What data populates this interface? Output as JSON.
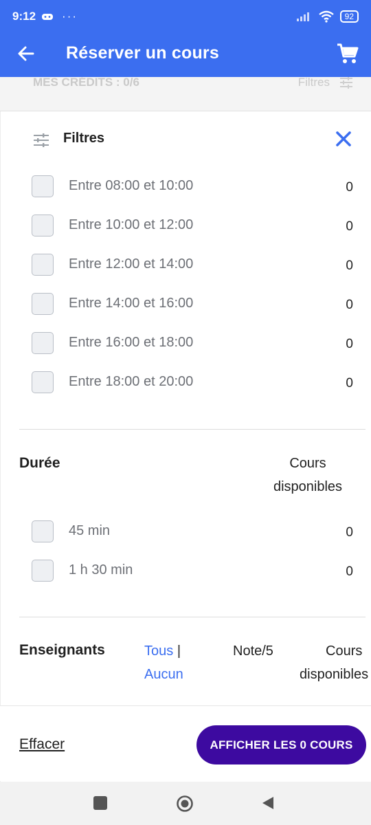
{
  "status": {
    "time": "9:12",
    "more": "···",
    "battery": "92"
  },
  "appbar": {
    "title": "Réserver un cours"
  },
  "underbar": {
    "credits": "MES CRÉDITS : 0/6",
    "filters": "Filtres"
  },
  "filters": {
    "title": "Filtres",
    "time_slots": [
      {
        "label": "Entre 08:00 et 10:00",
        "count": "0"
      },
      {
        "label": "Entre 10:00 et 12:00",
        "count": "0"
      },
      {
        "label": "Entre 12:00 et 14:00",
        "count": "0"
      },
      {
        "label": "Entre 14:00 et 16:00",
        "count": "0"
      },
      {
        "label": "Entre 16:00 et 18:00",
        "count": "0"
      },
      {
        "label": "Entre 18:00 et 20:00",
        "count": "0"
      }
    ],
    "duration": {
      "title": "Durée",
      "available_label_1": "Cours",
      "available_label_2": "disponibles",
      "items": [
        {
          "label": "45 min",
          "count": "0"
        },
        {
          "label": "1 h 30 min",
          "count": "0"
        }
      ]
    },
    "teachers": {
      "title": "Enseignants",
      "all": "Tous",
      "sep": "|",
      "none": "Aucun",
      "rating": "Note/5",
      "available_1": "Cours",
      "available_2": "disponibles"
    }
  },
  "footer": {
    "clear": "Effacer",
    "show": "AFFICHER LES 0 COURS"
  },
  "colors": {
    "primary": "#3b6ef0",
    "cta": "#3d0aa0"
  }
}
